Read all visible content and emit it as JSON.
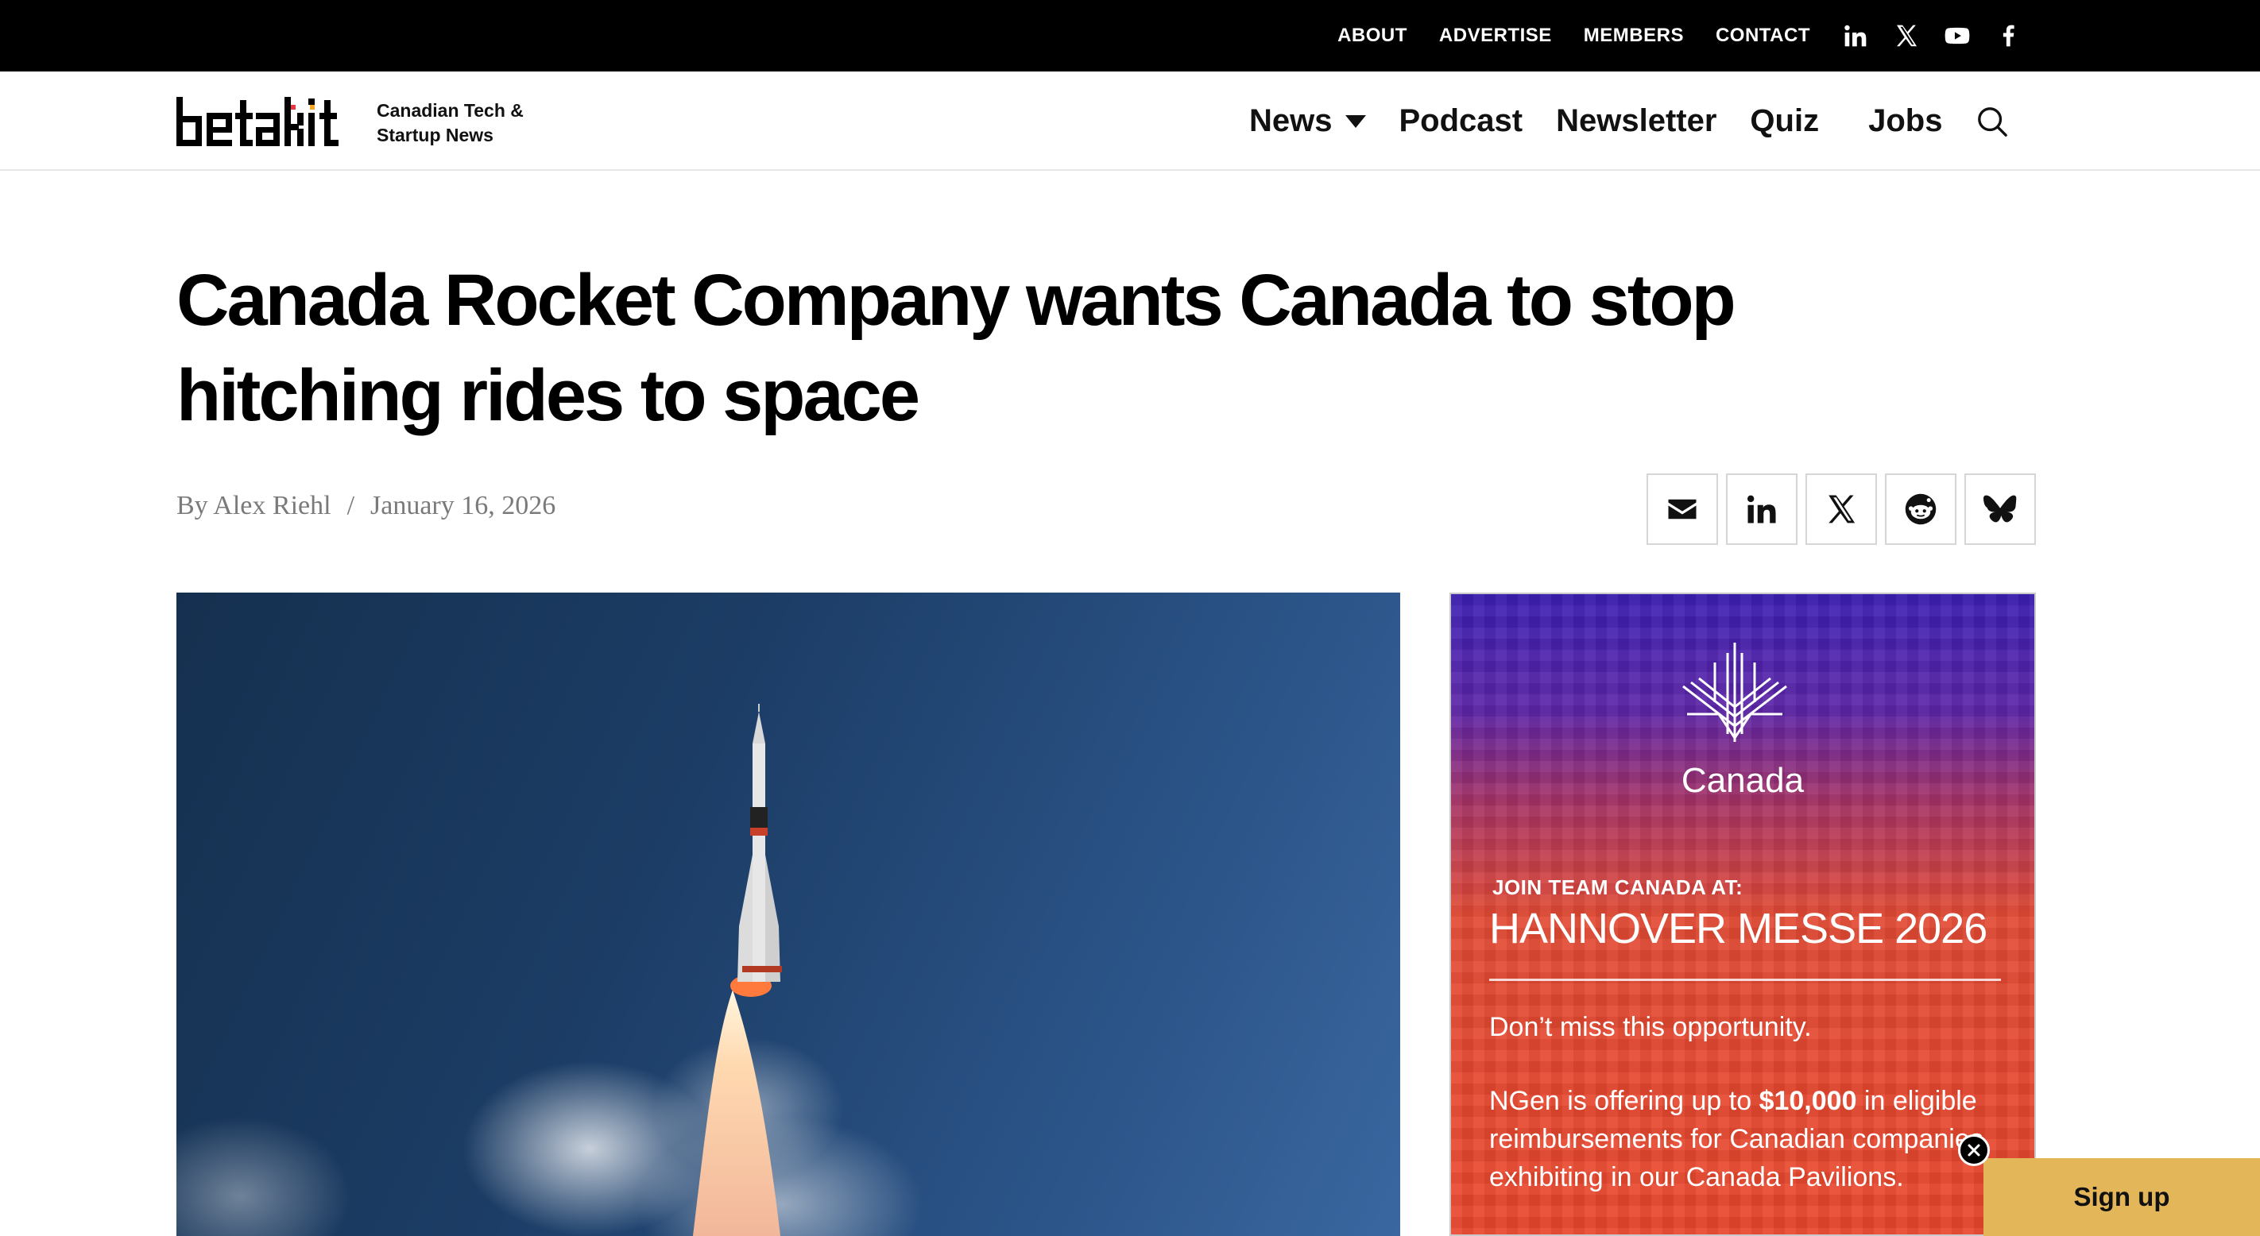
{
  "topbar": {
    "links": [
      "ABOUT",
      "ADVERTISE",
      "MEMBERS",
      "CONTACT"
    ],
    "social_icons": [
      "linkedin-icon",
      "x-icon",
      "youtube-icon",
      "facebook-icon"
    ]
  },
  "header": {
    "logo_text": "betakit",
    "tagline_line1": "Canadian Tech &",
    "tagline_line2": "Startup News",
    "nav": {
      "news": "News",
      "podcast": "Podcast",
      "newsletter": "Newsletter",
      "quiz": "Quiz",
      "jobs": "Jobs"
    },
    "search_icon": "search-icon"
  },
  "article": {
    "title": "Canada Rocket Company wants Canada to stop hitching rides to space",
    "byline": "By Alex Riehl",
    "separator": "/",
    "date": "January 16, 2026",
    "share_icons": [
      "email-icon",
      "linkedin-icon",
      "x-icon",
      "reddit-icon",
      "bluesky-icon"
    ]
  },
  "ad": {
    "brand": "Canada",
    "kicker": "JOIN TEAM CANADA AT:",
    "title": "HANNOVER MESSE 2026",
    "line1": "Don’t miss this opportunity.",
    "body_pre": "NGen is offering up to ",
    "body_amount": "$10,000",
    "body_post": " in eligible reimbursements for Canadian companies exhibiting in our Canada Pavilions.",
    "colors": {
      "top": "#3b1fb3",
      "bottom": "#e9472d"
    }
  },
  "signup": {
    "label": "Sign up",
    "color": "#e3b659"
  }
}
